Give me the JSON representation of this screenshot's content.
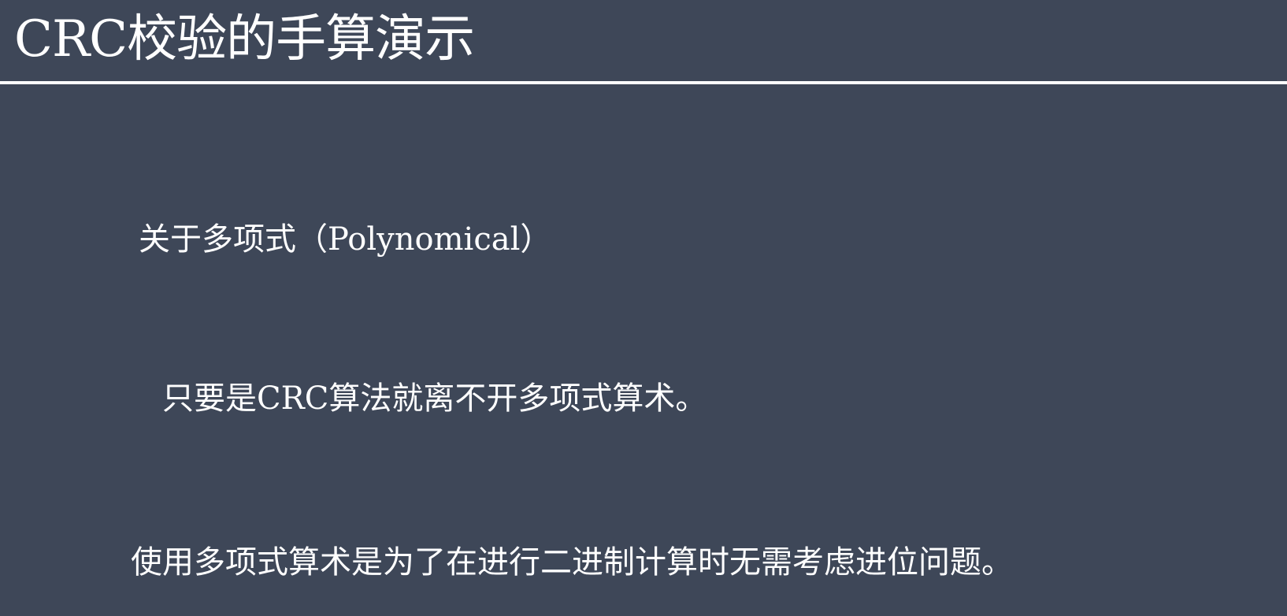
{
  "slide": {
    "title": "CRC校验的手算演示",
    "lines": [
      "关于多项式（Polynomical）",
      "只要是CRC算法就离不开多项式算术。",
      "使用多项式算术是为了在进行二进制计算时无需考虑进位问题。"
    ]
  },
  "colors": {
    "background": "#3e4758",
    "text": "#ffffff",
    "rule": "#ffffff"
  }
}
